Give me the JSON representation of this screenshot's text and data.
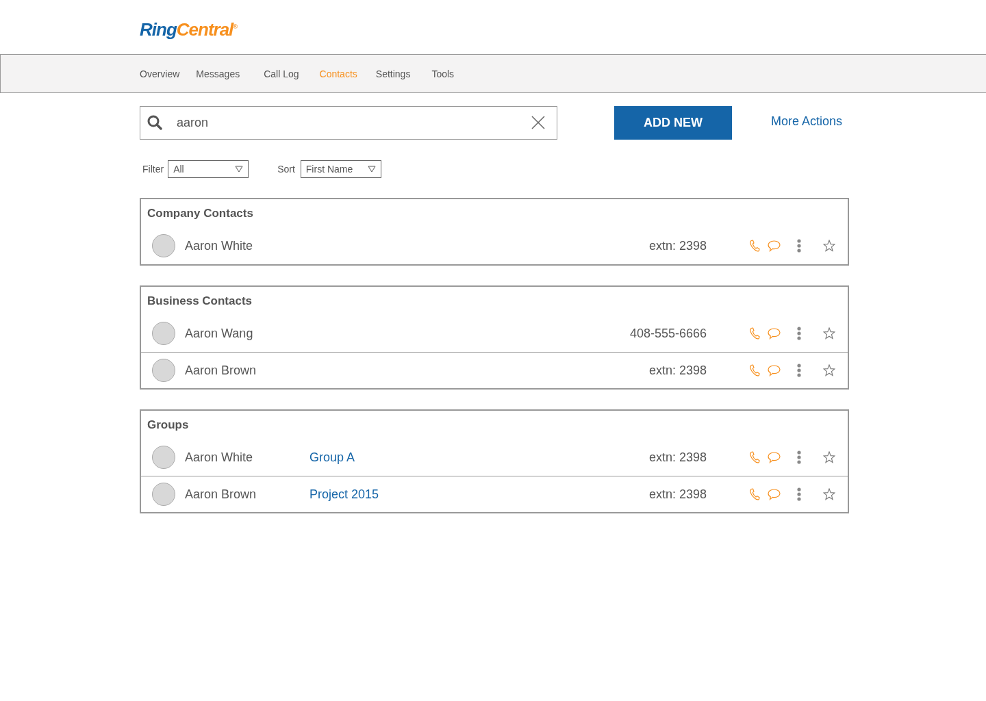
{
  "logo": {
    "part_1": "Ring",
    "part_2": "Central",
    "mark": "®"
  },
  "nav": [
    {
      "label": "Overview",
      "selected": false
    },
    {
      "label": "Messages",
      "selected": false
    },
    {
      "label": "Call Log",
      "selected": false
    },
    {
      "label": "Contacts",
      "selected": true
    },
    {
      "label": "Settings",
      "selected": false
    },
    {
      "label": "Tools",
      "selected": false
    }
  ],
  "search": {
    "value": "aaron"
  },
  "add_button": "ADD NEW",
  "more_actions": "More Actions",
  "filter": {
    "label": "Filter",
    "value": "All"
  },
  "sort": {
    "label": "Sort",
    "value": "First Name"
  },
  "sections": [
    {
      "title": "Company Contacts",
      "contacts": [
        {
          "name": "Aaron White",
          "number": "extn: 2398",
          "starred": false
        }
      ]
    },
    {
      "title": "Business Contacts",
      "contacts": [
        {
          "name": "Aaron Wang",
          "number": "408-555-6666",
          "starred": false
        },
        {
          "name": "Aaron Brown",
          "number": "extn: 2398",
          "starred": false
        }
      ]
    },
    {
      "title": "Groups",
      "contacts": [
        {
          "name": "Aaron White",
          "group": "Group A",
          "number": "extn: 2398",
          "starred": false
        },
        {
          "name": "Aaron Brown",
          "group": "Project 2015",
          "number": "extn: 2398",
          "starred": false
        }
      ]
    }
  ]
}
